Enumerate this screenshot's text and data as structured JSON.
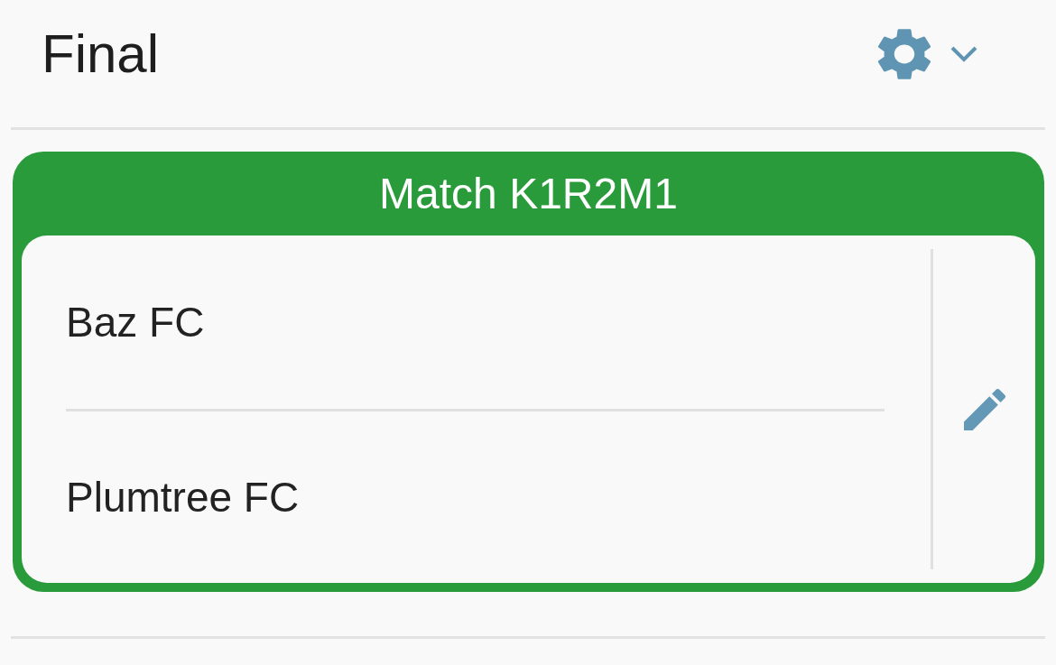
{
  "header": {
    "title": "Final"
  },
  "match": {
    "title": "Match K1R2M1",
    "teams": [
      {
        "name": "Baz FC"
      },
      {
        "name": "Plumtree FC"
      }
    ]
  }
}
